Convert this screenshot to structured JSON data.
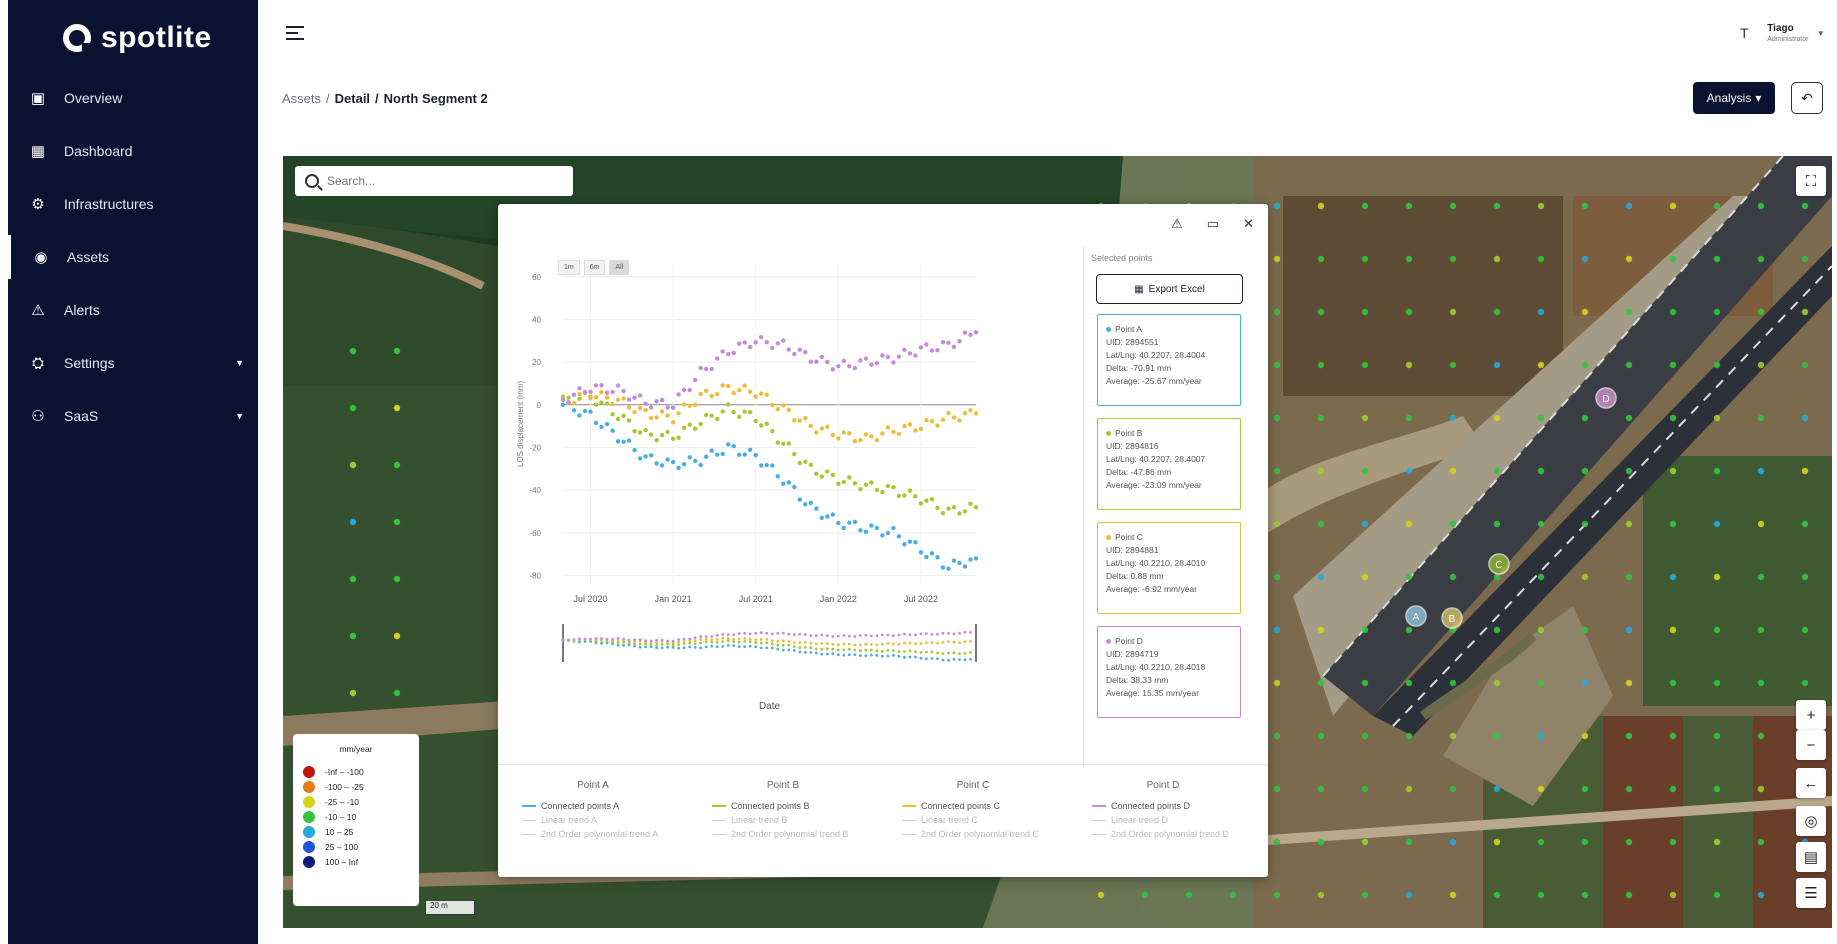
{
  "app": {
    "logo_text": "spotlite"
  },
  "sidebar": {
    "items": [
      {
        "label": "Overview",
        "icon": "overview-icon",
        "active": false,
        "has_caret": false
      },
      {
        "label": "Dashboard",
        "icon": "dashboard-icon",
        "active": false,
        "has_caret": false
      },
      {
        "label": "Infrastructures",
        "icon": "infrastructure-icon",
        "active": false,
        "has_caret": false
      },
      {
        "label": "Assets",
        "icon": "location-pin-icon",
        "active": true,
        "has_caret": false
      },
      {
        "label": "Alerts",
        "icon": "warning-icon",
        "active": false,
        "has_caret": false
      },
      {
        "label": "Settings",
        "icon": "settings-icon",
        "active": false,
        "has_caret": true
      },
      {
        "label": "SaaS",
        "icon": "user-icon",
        "active": false,
        "has_caret": true
      }
    ]
  },
  "header": {
    "user_initial": "T",
    "user_name": "Tiago",
    "user_role": "Administrator",
    "breadcrumb": {
      "part1": "Assets",
      "sep": "/",
      "part2": "Detail",
      "part3": "North Segment 2"
    },
    "analysis_label": "Analysis",
    "analysis_caret": "▾",
    "back_icon": "↶"
  },
  "map": {
    "search_placeholder": "Search...",
    "scale_label": "20 m",
    "controls": {
      "layers": "⛶",
      "zoom_in": "+",
      "zoom_out": "−",
      "back": "←",
      "locate": "◎",
      "map_view": "▤",
      "filters": "☰"
    },
    "markers": [
      {
        "label": "A"
      },
      {
        "label": "B"
      },
      {
        "label": "C"
      },
      {
        "label": "D"
      }
    ],
    "legend": {
      "title": "mm/year",
      "rows": [
        {
          "range": "-Inf  –  -100",
          "color": "#c0150f"
        },
        {
          "range": "-100  –  -25",
          "color": "#e87a18"
        },
        {
          "range": "-25  –  -10",
          "color": "#d9d21c"
        },
        {
          "range": "-10  –  10",
          "color": "#33c43f"
        },
        {
          "range": "10  –  25",
          "color": "#27a9d6"
        },
        {
          "range": "25  –  100",
          "color": "#2157d6"
        },
        {
          "range": "100  –  Inf",
          "color": "#0d1a7a"
        }
      ]
    }
  },
  "modal": {
    "actions": {
      "alert": "⚠",
      "maximize": "▭",
      "close": "✕"
    },
    "range_buttons": [
      "1m",
      "6m",
      "All"
    ],
    "selected_points_title": "Selected points",
    "export_label": "Export Excel",
    "export_icon": "▦",
    "points": [
      {
        "name": "Point A",
        "uid": "UID: 2894551",
        "latlng": "Lat/Lng: 40.2207, 28.4004",
        "delta": "Delta: -70.91 mm",
        "average": "Average: -25.67 mm/year",
        "color": "#49aee0"
      },
      {
        "name": "Point B",
        "uid": "UID: 2894816",
        "latlng": "Lat/Lng: 40.2207, 28.4007",
        "delta": "Delta: -47.86 mm",
        "average": "Average: -23.09 mm/year",
        "color": "#a2c933"
      },
      {
        "name": "Point C",
        "uid": "UID: 2894881",
        "latlng": "Lat/Lng: 40.2210, 28.4010",
        "delta": "Delta: 0.88 mm",
        "average": "Average: -6.92 mm/year",
        "color": "#eebc3b"
      },
      {
        "name": "Point D",
        "uid": "UID: 2894719",
        "latlng": "Lat/Lng: 40.2210, 28.4018",
        "delta": "Delta: 38.33 mm",
        "average": "Average: 15.35 mm/year",
        "color": "#c58ad8"
      }
    ],
    "series_legend": [
      {
        "head": "Point A",
        "main": "Connected points A",
        "trend": "Linear trend A",
        "poly": "2nd Order polynomial trend A"
      },
      {
        "head": "Point B",
        "main": "Connected points B",
        "trend": "Linear trend B",
        "poly": "2nd Order polynomial trend B"
      },
      {
        "head": "Point C",
        "main": "Connected points C",
        "trend": "Linear trend C",
        "poly": "2nd Order polynomial trend C"
      },
      {
        "head": "Point D",
        "main": "Connected points D",
        "trend": "Linear trend D",
        "poly": "2nd Order polynomial trend D"
      }
    ]
  },
  "chart_data": {
    "type": "scatter",
    "title": "",
    "xlabel": "Date",
    "ylabel": "LOS displacement (mm)",
    "x_ticks": [
      "Jul 2020",
      "Jan 2021",
      "Jul 2021",
      "Jan 2022",
      "Jul 2022"
    ],
    "y_ticks": [
      60,
      40,
      20,
      0,
      -20,
      -40,
      -60,
      -80
    ],
    "ylim": [
      -84,
      66
    ],
    "xlim_months": [
      0,
      30
    ],
    "grid": true,
    "legend_position": "bottom",
    "range_slider": true,
    "series": [
      {
        "name": "Point A",
        "color": "#49aee0",
        "x_month_offsets": [
          0,
          2,
          4,
          6,
          8,
          10,
          12,
          14,
          16,
          18,
          20,
          22,
          24,
          26,
          28,
          30
        ],
        "values": [
          0,
          -5,
          -15,
          -25,
          -28,
          -26,
          -20,
          -24,
          -35,
          -48,
          -55,
          -58,
          -60,
          -68,
          -76,
          -72
        ]
      },
      {
        "name": "Point B",
        "color": "#a2c933",
        "x_month_offsets": [
          0,
          2,
          4,
          6,
          8,
          10,
          12,
          14,
          16,
          18,
          20,
          22,
          24,
          26,
          28,
          30
        ],
        "values": [
          2,
          4,
          -5,
          -14,
          -15,
          -8,
          -2,
          -6,
          -18,
          -30,
          -35,
          -38,
          -40,
          -44,
          -50,
          -48
        ]
      },
      {
        "name": "Point C",
        "color": "#eebc3b",
        "x_month_offsets": [
          0,
          2,
          4,
          6,
          8,
          10,
          12,
          14,
          16,
          18,
          20,
          22,
          24,
          26,
          28,
          30
        ],
        "values": [
          1,
          5,
          2,
          -4,
          -6,
          4,
          8,
          6,
          -2,
          -10,
          -14,
          -16,
          -12,
          -10,
          -6,
          -4
        ]
      },
      {
        "name": "Point D",
        "color": "#c58ad8",
        "x_month_offsets": [
          0,
          2,
          4,
          6,
          8,
          10,
          12,
          14,
          16,
          18,
          20,
          22,
          24,
          26,
          28,
          30
        ],
        "values": [
          2,
          8,
          7,
          1,
          0,
          15,
          25,
          30,
          28,
          22,
          18,
          20,
          22,
          26,
          28,
          34
        ]
      }
    ]
  }
}
